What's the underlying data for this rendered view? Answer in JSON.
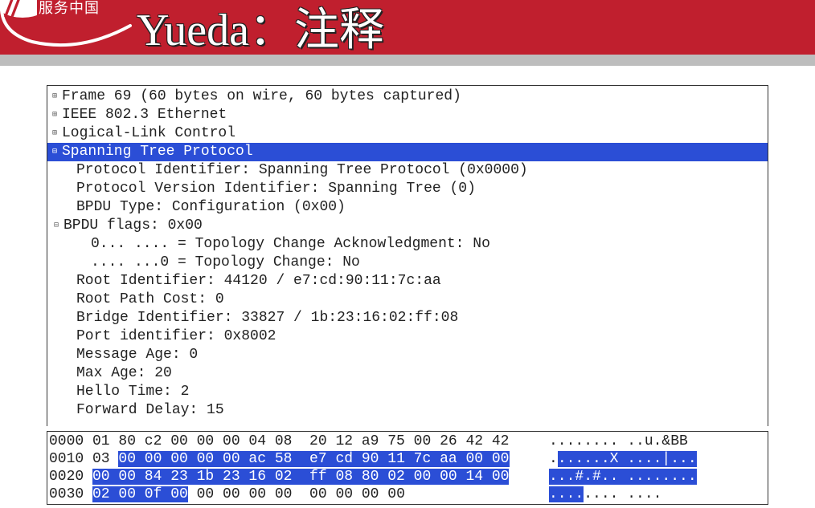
{
  "header": {
    "logo_cn": "服务中国",
    "title": "Yueda：注释"
  },
  "tree": {
    "rows": [
      {
        "i": 0,
        "glyph": "plus",
        "sel": false,
        "text": "Frame 69 (60 bytes on wire, 60 bytes captured)"
      },
      {
        "i": 0,
        "glyph": "plus",
        "sel": false,
        "text": "IEEE 802.3 Ethernet"
      },
      {
        "i": 0,
        "glyph": "plus",
        "sel": false,
        "text": "Logical-Link Control"
      },
      {
        "i": 0,
        "glyph": "minus",
        "sel": true,
        "text": "Spanning Tree Protocol"
      },
      {
        "i": 1,
        "glyph": "",
        "sel": false,
        "text": "Protocol Identifier: Spanning Tree Protocol (0x0000)"
      },
      {
        "i": 1,
        "glyph": "",
        "sel": false,
        "text": "Protocol Version Identifier: Spanning Tree (0)"
      },
      {
        "i": 1,
        "glyph": "",
        "sel": false,
        "text": "BPDU Type: Configuration (0x00)"
      },
      {
        "i": 1,
        "glyph": "minus",
        "sel": false,
        "text": "BPDU flags: 0x00",
        "shift": -16
      },
      {
        "i": 2,
        "glyph": "",
        "sel": false,
        "text": "0... .... = Topology Change Acknowledgment: No"
      },
      {
        "i": 2,
        "glyph": "",
        "sel": false,
        "text": ".... ...0 = Topology Change: No"
      },
      {
        "i": 1,
        "glyph": "",
        "sel": false,
        "text": "Root Identifier: 44120 / e7:cd:90:11:7c:aa"
      },
      {
        "i": 1,
        "glyph": "",
        "sel": false,
        "text": "Root Path Cost: 0"
      },
      {
        "i": 1,
        "glyph": "",
        "sel": false,
        "text": "Bridge Identifier: 33827 / 1b:23:16:02:ff:08"
      },
      {
        "i": 1,
        "glyph": "",
        "sel": false,
        "text": "Port identifier: 0x8002"
      },
      {
        "i": 1,
        "glyph": "",
        "sel": false,
        "text": "Message Age: 0"
      },
      {
        "i": 1,
        "glyph": "",
        "sel": false,
        "text": "Max Age: 20"
      },
      {
        "i": 1,
        "glyph": "",
        "sel": false,
        "text": "Hello Time: 2"
      },
      {
        "i": 1,
        "glyph": "",
        "sel": false,
        "text": "Forward Delay: 15"
      }
    ]
  },
  "hex": {
    "lines": [
      {
        "offset": "0000",
        "segs": [
          {
            "t": "01 80 c2 00 00 00 04 08  20 12 a9 75 00 26 42 42",
            "hl": false
          }
        ],
        "ascii_segs": [
          {
            "t": "........ ..u.&BB",
            "hl": false
          }
        ]
      },
      {
        "offset": "0010",
        "segs": [
          {
            "t": "03 ",
            "hl": false
          },
          {
            "t": "00 00 00 00 00 ac 58  e7 cd 90 11 7c aa 00 00",
            "hl": true
          }
        ],
        "ascii_segs": [
          {
            "t": ".",
            "hl": false
          },
          {
            "t": "......X ....|...",
            "hl": true
          }
        ]
      },
      {
        "offset": "0020",
        "segs": [
          {
            "t": "00 00 84 23 1b 23 16 02  ff 08 80 02 00 00 14 00",
            "hl": true
          }
        ],
        "ascii_segs": [
          {
            "t": "...#.#.. ........",
            "hl": true
          }
        ]
      },
      {
        "offset": "0030",
        "segs": [
          {
            "t": "02 00 0f 00",
            "hl": true
          },
          {
            "t": " 00 00 00 00  00 00 00 00",
            "hl": false
          }
        ],
        "ascii_segs": [
          {
            "t": "....",
            "hl": true
          },
          {
            "t": ".... ....",
            "hl": false
          }
        ]
      }
    ]
  }
}
